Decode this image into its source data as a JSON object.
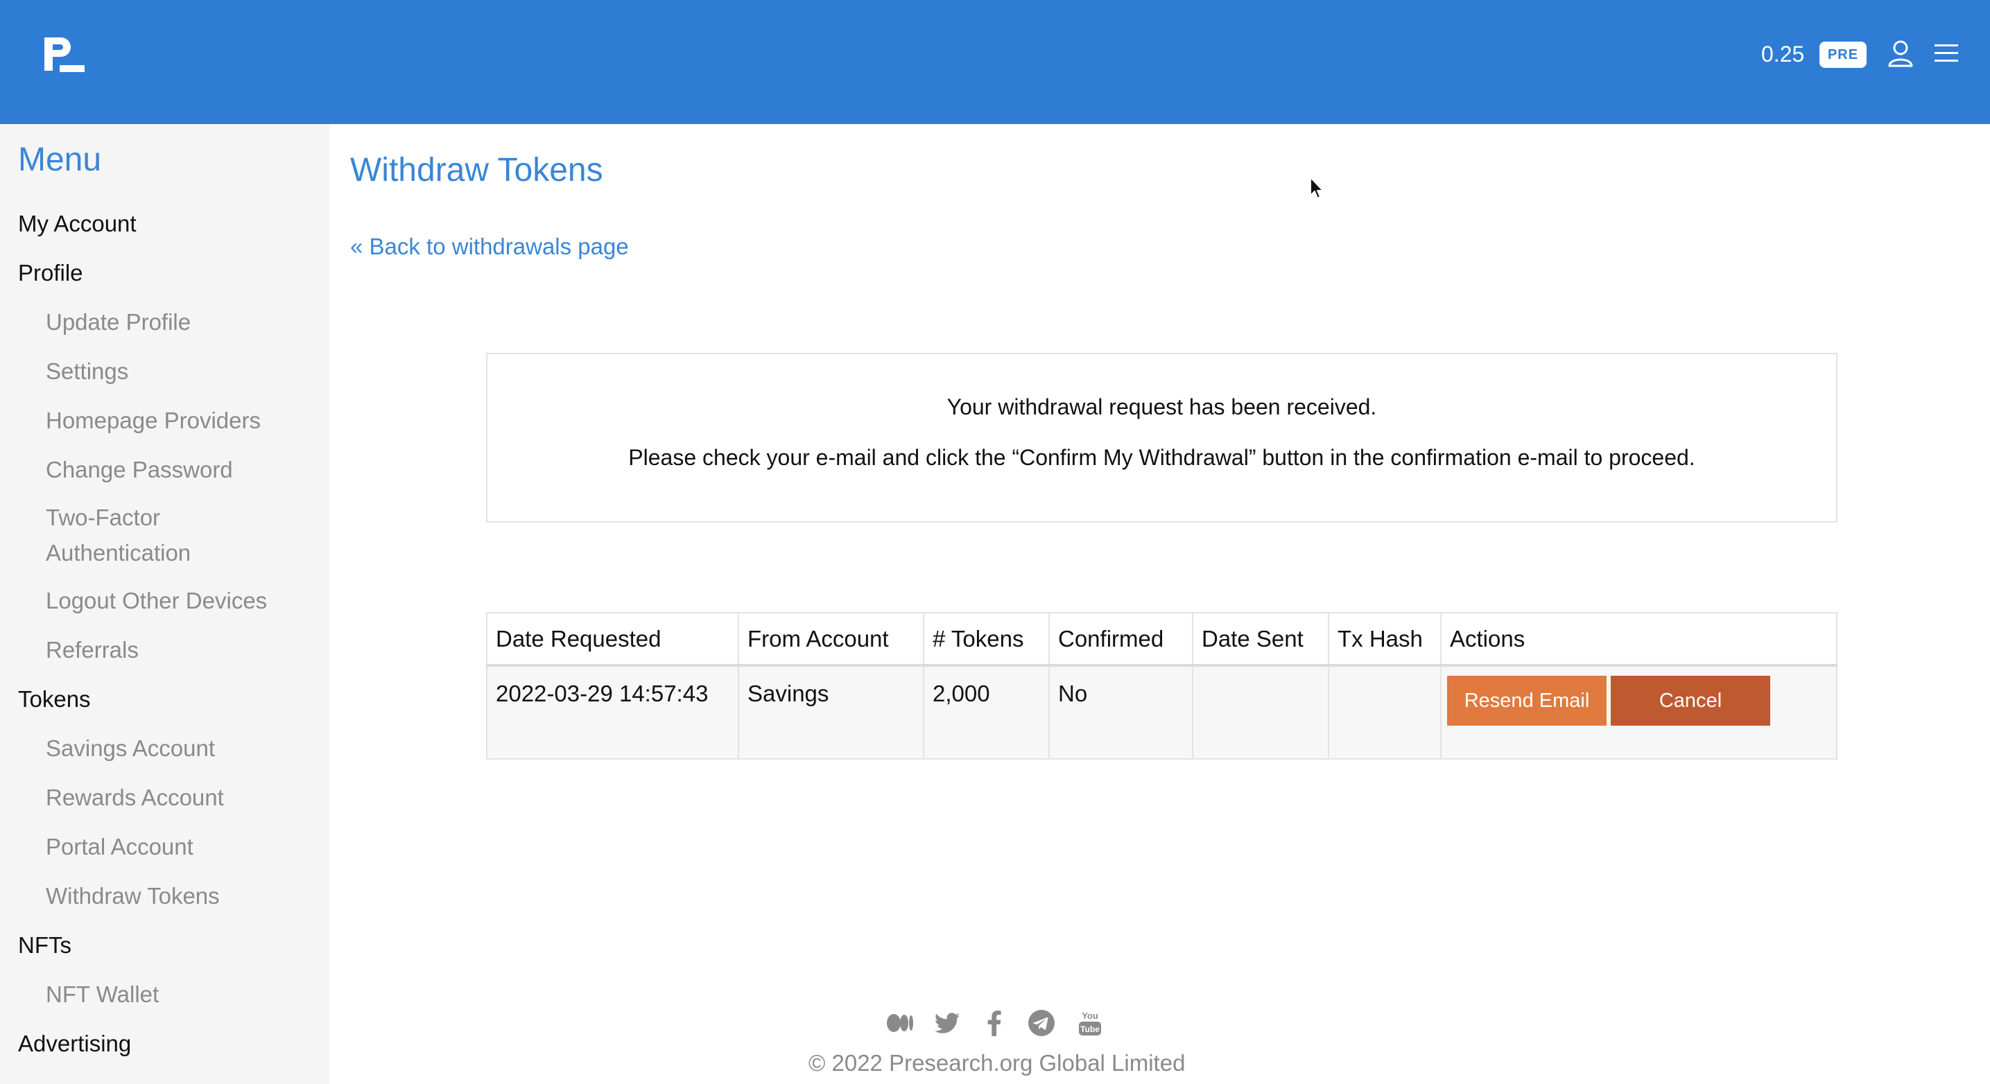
{
  "header": {
    "balance": "0.25",
    "badge": "PRE",
    "brand_color": "#2f7cd4",
    "icons": [
      "logo-icon",
      "user-icon",
      "hamburger-menu-icon"
    ]
  },
  "sidebar": {
    "title": "Menu",
    "sections": [
      {
        "label": "My Account",
        "items": []
      },
      {
        "label": "Profile",
        "items": [
          "Update Profile",
          "Settings",
          "Homepage Providers",
          "Change Password",
          "Two-Factor Authentication",
          "Logout Other Devices",
          "Referrals"
        ]
      },
      {
        "label": "Tokens",
        "items": [
          "Savings Account",
          "Rewards Account",
          "Portal Account",
          "Withdraw Tokens"
        ]
      },
      {
        "label": "NFTs",
        "items": [
          "NFT Wallet"
        ]
      },
      {
        "label": "Advertising",
        "items": []
      }
    ],
    "two_factor_lines": [
      "Two-Factor",
      "Authentication"
    ]
  },
  "main": {
    "title": "Withdraw Tokens",
    "back_link": "« Back to withdrawals page",
    "notice": {
      "line1": "Your withdrawal request has been received.",
      "line2": "Please check your e-mail and click the “Confirm My Withdrawal” button in the confirmation e-mail to proceed."
    },
    "table": {
      "headers": [
        "Date Requested",
        "From Account",
        "# Tokens",
        "Confirmed",
        "Date Sent",
        "Tx Hash",
        "Actions"
      ],
      "rows": [
        {
          "date_requested": "2022-03-29 14:57:43",
          "from_account": "Savings",
          "tokens": "2,000",
          "confirmed": "No",
          "date_sent": "",
          "tx_hash": ""
        }
      ]
    },
    "actions": {
      "resend": "Resend Email",
      "cancel": "Cancel",
      "resend_color": "#e07a3f",
      "cancel_color": "#bf5a30"
    }
  },
  "footer": {
    "social_icons": [
      "medium-icon",
      "twitter-icon",
      "facebook-icon",
      "telegram-icon",
      "youtube-icon"
    ],
    "copyright": "© 2022 Presearch.org Global Limited"
  }
}
